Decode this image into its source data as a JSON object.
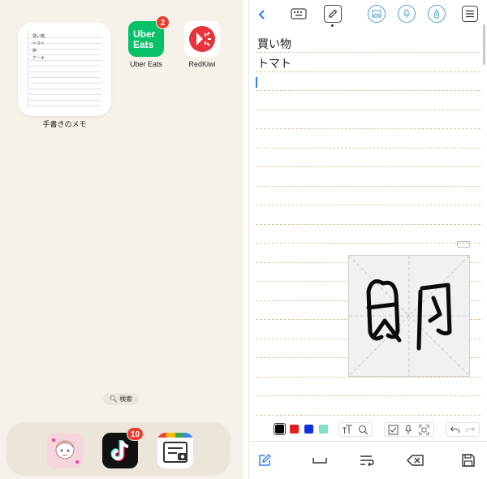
{
  "home": {
    "widget": {
      "label": "手書きのメモ",
      "lines": [
        "買い物",
        "トマト",
        "卵",
        "ケーキ"
      ]
    },
    "apps": [
      {
        "id": "uber-eats",
        "label": "Uber Eats",
        "badge": "2",
        "logo_line1": "Uber",
        "logo_line2": "Eats",
        "color": "#06c167"
      },
      {
        "id": "redkiwi",
        "label": "RedKiwi",
        "color": "#e8333a"
      }
    ],
    "search_label": "検索",
    "dock": [
      {
        "id": "anime-app",
        "color": "#f5d6dc"
      },
      {
        "id": "tiktok",
        "badge": "10",
        "color": "#111111"
      },
      {
        "id": "note-camera-app",
        "color": "#ffffff"
      }
    ]
  },
  "note": {
    "lines": [
      "買い物",
      "トマト"
    ],
    "canvas_glyphs": "卵",
    "ink_colors": [
      "#000000",
      "#e02020",
      "#1030e0",
      "#7fe0c8"
    ],
    "accent": "#4aa3c8",
    "nav_color": "#2f7cf6"
  }
}
